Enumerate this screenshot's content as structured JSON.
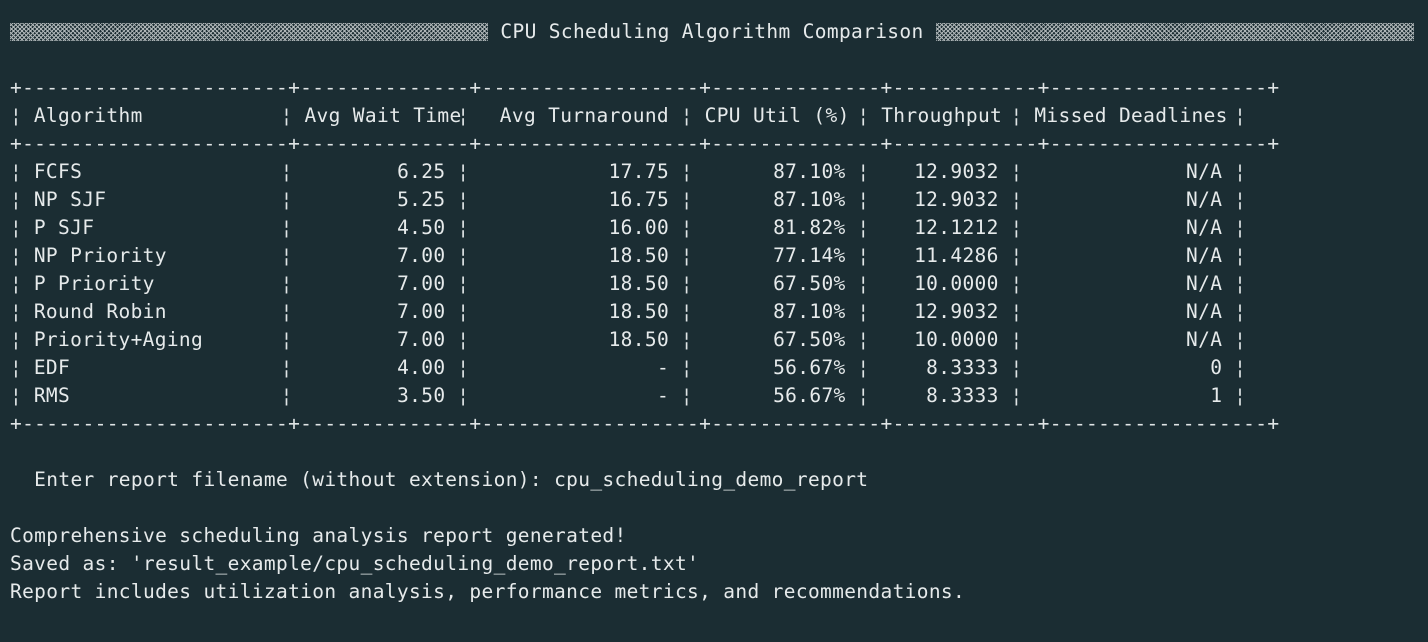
{
  "title": "CPU Scheduling Algorithm Comparison",
  "table": {
    "border": "+----------------------+--------------+------------------+--------------+------------+------------------+",
    "headers": [
      "Algorithm",
      "Avg Wait Time",
      "Avg Turnaround",
      "CPU Util (%)",
      "Throughput",
      "Missed Deadlines"
    ],
    "rows": [
      [
        "FCFS",
        "6.25",
        "17.75",
        "87.10%",
        "12.9032",
        "N/A"
      ],
      [
        "NP SJF",
        "5.25",
        "16.75",
        "87.10%",
        "12.9032",
        "N/A"
      ],
      [
        "P SJF",
        "4.50",
        "16.00",
        "81.82%",
        "12.1212",
        "N/A"
      ],
      [
        "NP Priority",
        "7.00",
        "18.50",
        "77.14%",
        "11.4286",
        "N/A"
      ],
      [
        "P Priority",
        "7.00",
        "18.50",
        "67.50%",
        "10.0000",
        "N/A"
      ],
      [
        "Round Robin",
        "7.00",
        "18.50",
        "87.10%",
        "12.9032",
        "N/A"
      ],
      [
        "Priority+Aging",
        "7.00",
        "18.50",
        "67.50%",
        "10.0000",
        "N/A"
      ],
      [
        "EDF",
        "4.00",
        "-",
        "56.67%",
        "8.3333",
        "0"
      ],
      [
        "RMS",
        "3.50",
        "-",
        "56.67%",
        "8.3333",
        "1"
      ]
    ]
  },
  "prompt": {
    "label": "  Enter report filename (without extension): ",
    "value": "cpu_scheduling_demo_report"
  },
  "messages": [
    "Comprehensive scheduling analysis report generated!",
    "Saved as: 'result_example/cpu_scheduling_demo_report.txt'",
    "Report includes utilization analysis, performance metrics, and recommendations."
  ],
  "colors": {
    "background": "#1b2d33",
    "foreground": "#e6eaeb"
  }
}
